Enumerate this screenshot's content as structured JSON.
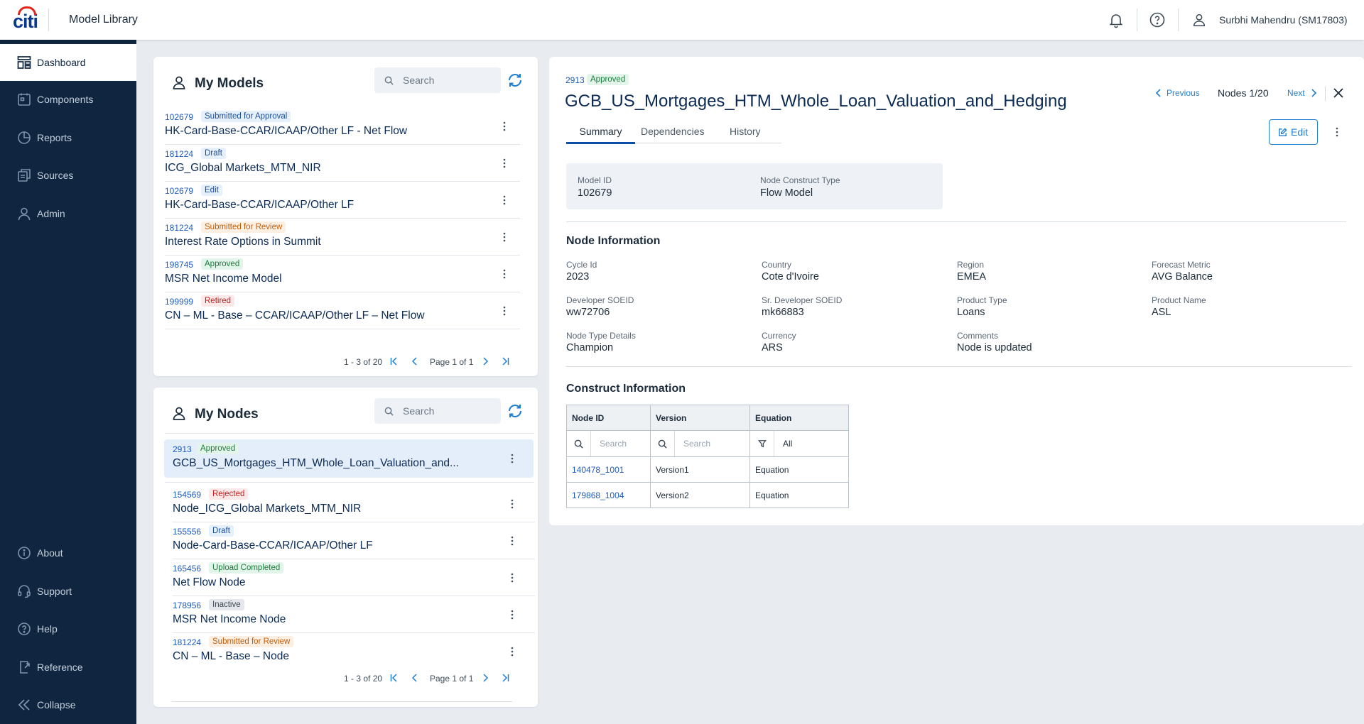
{
  "header": {
    "logo_text": "citi",
    "app_title": "Model Library",
    "user_name": "Surbhi Mahendru (SM17803)"
  },
  "sidebar": {
    "items": [
      {
        "label": "Dashboard",
        "icon": "dashboard-icon"
      },
      {
        "label": "Components",
        "icon": "components-icon"
      },
      {
        "label": "Reports",
        "icon": "reports-icon"
      },
      {
        "label": "Sources",
        "icon": "sources-icon"
      },
      {
        "label": "Admin",
        "icon": "admin-icon"
      }
    ],
    "bottom_items": [
      {
        "label": "About",
        "icon": "info-icon"
      },
      {
        "label": "Support",
        "icon": "headset-icon"
      },
      {
        "label": "Help",
        "icon": "help-icon"
      },
      {
        "label": "Reference",
        "icon": "reference-icon"
      },
      {
        "label": "Collapse",
        "icon": "collapse-icon"
      }
    ]
  },
  "my_models": {
    "title": "My Models",
    "search_placeholder": "Search",
    "rows": [
      {
        "id": "102679",
        "status": "Submitted for Approval",
        "status_color": "#1d4f9a",
        "name": "HK-Card-Base-CCAR/ICAAP/Other LF - Net Flow"
      },
      {
        "id": "181224",
        "status": "Draft",
        "status_color": "#1d4f9a",
        "name": "ICG_Global Markets_MTM_NIR"
      },
      {
        "id": "102679",
        "status": "Edit",
        "status_color": "#1d4f9a",
        "name": "HK-Card-Base-CCAR/ICAAP/Other LF"
      },
      {
        "id": "181224",
        "status": "Submitted for Review",
        "status_color": "#c25e0d",
        "name": "Interest Rate Options in Summit"
      },
      {
        "id": "198745",
        "status": "Approved",
        "status_color": "#1e7b3d",
        "name": "MSR Net Income Model"
      },
      {
        "id": "199999",
        "status": "Retired",
        "status_color": "#c5221f",
        "name": "CN – ML - Base – CCAR/ICAAP/Other LF – Net Flow"
      }
    ],
    "pager": {
      "range": "1 - 3 of 20",
      "page": "Page 1 of 1"
    }
  },
  "my_nodes": {
    "title": "My Nodes",
    "search_placeholder": "Search",
    "rows": [
      {
        "id": "2913",
        "status": "Approved",
        "status_color": "#1e7b3d",
        "name": "GCB_US_Mortgages_HTM_Whole_Loan_Valuation_and..."
      },
      {
        "id": "154569",
        "status": "Rejected",
        "status_color": "#c5221f",
        "name": "Node_ICG_Global Markets_MTM_NIR"
      },
      {
        "id": "155556",
        "status": "Draft",
        "status_color": "#1d4f9a",
        "name": "Node-Card-Base-CCAR/ICAAP/Other LF"
      },
      {
        "id": "165456",
        "status": "Upload Completed",
        "status_color": "#1e7b3d",
        "name": "Net Flow Node"
      },
      {
        "id": "178956",
        "status": "Inactive",
        "status_color": "#3d4a57",
        "name": "MSR Net Income Node"
      },
      {
        "id": "181224",
        "status": "Submitted for Review",
        "status_color": "#c25e0d",
        "name": "CN – ML - Base – Node"
      }
    ],
    "pager": {
      "range": "1 - 3 of 20",
      "page": "Page 1 of 1"
    }
  },
  "detail": {
    "id": "2913",
    "status": "Approved",
    "title": "GCB_US_Mortgages_HTM_Whole_Loan_Valuation_and_Hedging",
    "previous_label": "Previous",
    "nodes_counter": "Nodes 1/20",
    "next_label": "Next",
    "edit_label": "Edit",
    "tabs": [
      "Summary",
      "Dependencies",
      "History"
    ],
    "model_id_label": "Model ID",
    "model_id": "102679",
    "construct_type_label": "Node Construct Type",
    "construct_type": "Flow Model",
    "node_info_title": "Node Information",
    "node_info": [
      {
        "label": "Cycle Id",
        "value": "2023"
      },
      {
        "label": "Country",
        "value": "Cote d'Ivoire"
      },
      {
        "label": "Region",
        "value": "EMEA"
      },
      {
        "label": "Forecast Metric",
        "value": "AVG Balance"
      },
      {
        "label": "Developer SOEID",
        "value": "ww72706"
      },
      {
        "label": "Sr. Developer SOEID",
        "value": "mk66883"
      },
      {
        "label": "Product Type",
        "value": "Loans"
      },
      {
        "label": "Product Name",
        "value": "ASL"
      },
      {
        "label": "Node Type Details",
        "value": "Champion"
      },
      {
        "label": "Currency",
        "value": "ARS"
      },
      {
        "label": "Comments",
        "value": "Node is updated"
      }
    ],
    "construct_title": "Construct Information",
    "table": {
      "headers": [
        "Node ID",
        "Version",
        "Equation"
      ],
      "search_placeholder": "Search",
      "filter_value": "All",
      "rows": [
        {
          "node_id": "140478_1001",
          "version": "Version1",
          "equation": "Equation"
        },
        {
          "node_id": "179868_1004",
          "version": "Version2",
          "equation": "Equation"
        }
      ]
    }
  }
}
